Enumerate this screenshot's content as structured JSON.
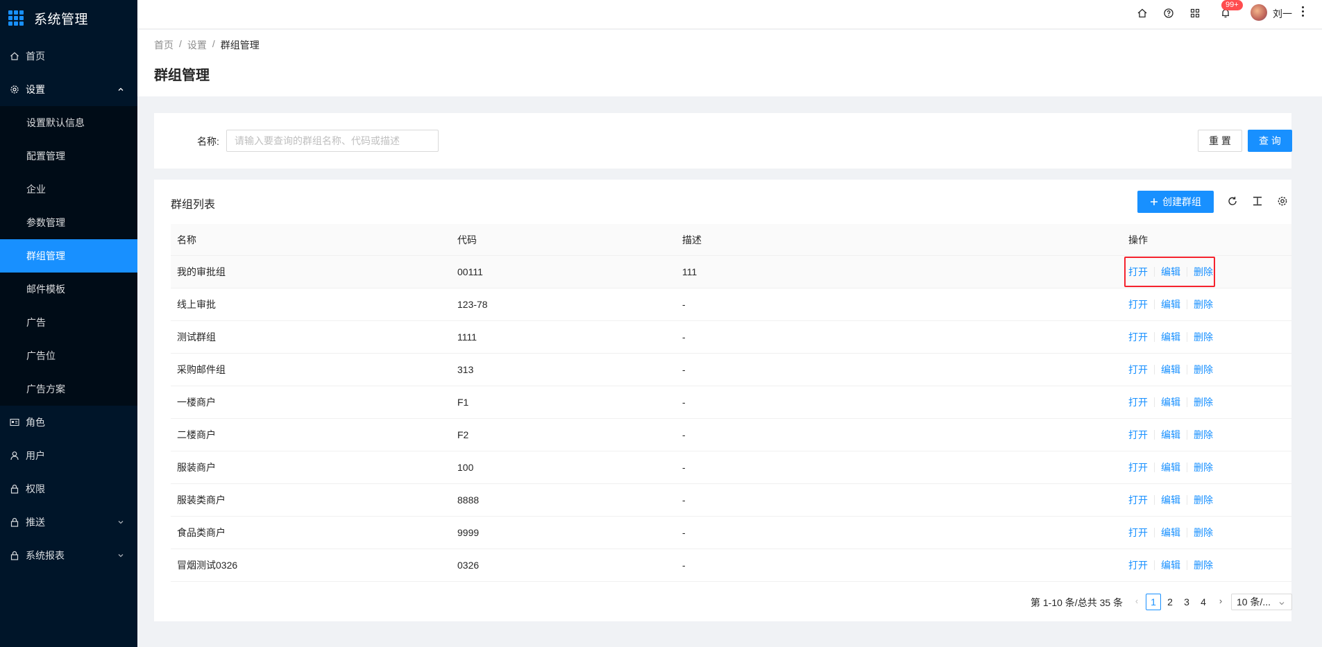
{
  "app": {
    "title": "系统管理"
  },
  "sidebar": {
    "items": [
      {
        "label": "首页",
        "icon": "home-icon"
      },
      {
        "label": "设置",
        "icon": "gear-icon",
        "expanded": true,
        "children": [
          {
            "label": "设置默认信息"
          },
          {
            "label": "配置管理"
          },
          {
            "label": "企业"
          },
          {
            "label": "参数管理"
          },
          {
            "label": "群组管理",
            "active": true
          },
          {
            "label": "邮件模板"
          },
          {
            "label": "广告"
          },
          {
            "label": "广告位"
          },
          {
            "label": "广告方案"
          }
        ]
      },
      {
        "label": "角色",
        "icon": "id-card-icon"
      },
      {
        "label": "用户",
        "icon": "user-icon"
      },
      {
        "label": "权限",
        "icon": "lock-icon"
      },
      {
        "label": "推送",
        "icon": "lock-icon"
      },
      {
        "label": "系统报表",
        "icon": "lock-icon"
      }
    ]
  },
  "header": {
    "notification_badge": "99+",
    "username": "刘一"
  },
  "breadcrumb": [
    "首页",
    "设置",
    "群组管理"
  ],
  "page_title": "群组管理",
  "search": {
    "label": "名称:",
    "placeholder": "请输入要查询的群组名称、代码或描述",
    "value": "",
    "reset_label": "重 置",
    "query_label": "查 询"
  },
  "table": {
    "title": "群组列表",
    "create_label": "创建群组",
    "columns": [
      "名称",
      "代码",
      "描述",
      "操作"
    ],
    "rows": [
      {
        "name": "我的审批组",
        "code": "00111",
        "desc": "111"
      },
      {
        "name": "线上审批",
        "code": "123-78",
        "desc": "-"
      },
      {
        "name": "测试群组",
        "code": "1111",
        "desc": "-"
      },
      {
        "name": "采购邮件组",
        "code": "313",
        "desc": "-"
      },
      {
        "name": "一楼商户",
        "code": "F1",
        "desc": "-"
      },
      {
        "name": "二楼商户",
        "code": "F2",
        "desc": "-"
      },
      {
        "name": "服装商户",
        "code": "100",
        "desc": "-"
      },
      {
        "name": "服装类商户",
        "code": "8888",
        "desc": "-"
      },
      {
        "name": "食品类商户",
        "code": "9999",
        "desc": "-"
      },
      {
        "name": "冒烟测试0326",
        "code": "0326",
        "desc": "-"
      }
    ],
    "actions": {
      "open": "打开",
      "edit": "编辑",
      "delete": "删除"
    }
  },
  "pagination": {
    "total_text": "第 1-10 条/总共 35 条",
    "pages": [
      "1",
      "2",
      "3",
      "4"
    ],
    "current": "1",
    "page_size": "10 条/..."
  },
  "colors": {
    "primary": "#1890ff",
    "sidebar_bg": "#001529",
    "highlight": "#f5222d"
  }
}
